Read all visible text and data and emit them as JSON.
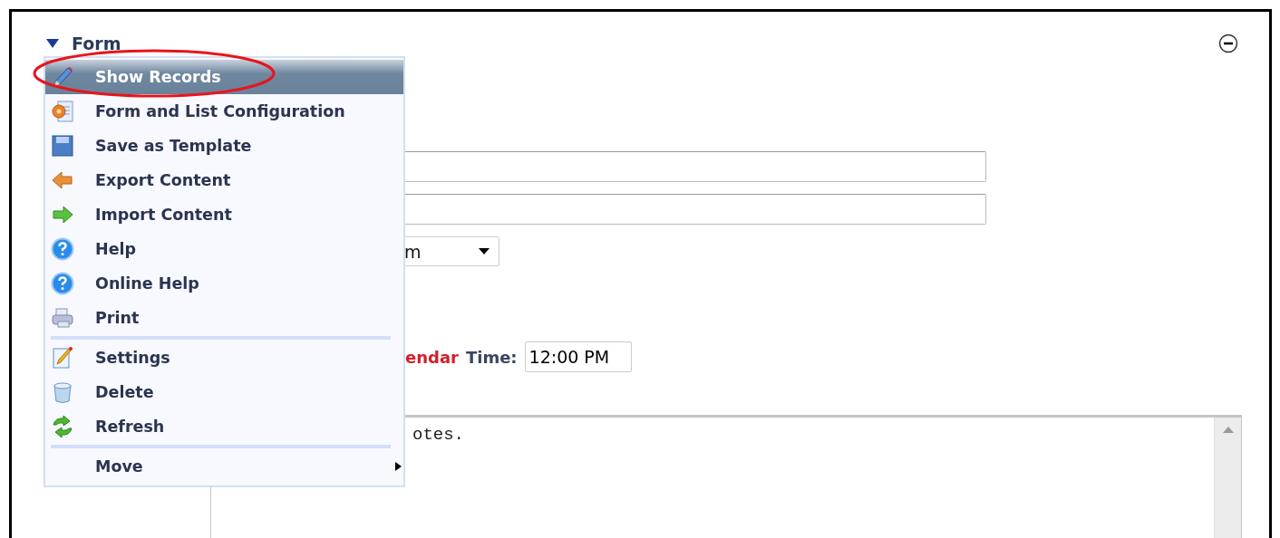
{
  "section": {
    "title": "Form",
    "expanded": true
  },
  "form": {
    "text_fields": [
      {
        "kind": "text"
      },
      {
        "kind": "text"
      }
    ],
    "dropdown": {
      "value": "m"
    },
    "date_link": "endar",
    "time_label": "Time:",
    "time_value": "12:00 PM",
    "notes": "otes."
  },
  "menu": {
    "groups": [
      [
        {
          "label": "Show Records",
          "selected": true,
          "kind": "item"
        },
        {
          "label": "Form and List Configuration",
          "selected": false,
          "kind": "item"
        },
        {
          "label": "Save as Template",
          "selected": false,
          "kind": "item"
        },
        {
          "label": "Export Content",
          "selected": false,
          "kind": "item"
        },
        {
          "label": "Import Content",
          "selected": false,
          "kind": "item"
        },
        {
          "label": "Help",
          "selected": false,
          "kind": "item"
        },
        {
          "label": "Online Help",
          "selected": false,
          "kind": "item"
        },
        {
          "label": "Print",
          "selected": false,
          "kind": "item"
        }
      ],
      [
        {
          "label": "Settings",
          "selected": false,
          "kind": "item"
        },
        {
          "label": "Delete",
          "selected": false,
          "kind": "item"
        },
        {
          "label": "Refresh",
          "selected": false,
          "kind": "item"
        }
      ],
      [
        {
          "label": "Move",
          "selected": false,
          "kind": "submenu"
        }
      ]
    ]
  },
  "annotation": {
    "highlight_selected": true
  }
}
